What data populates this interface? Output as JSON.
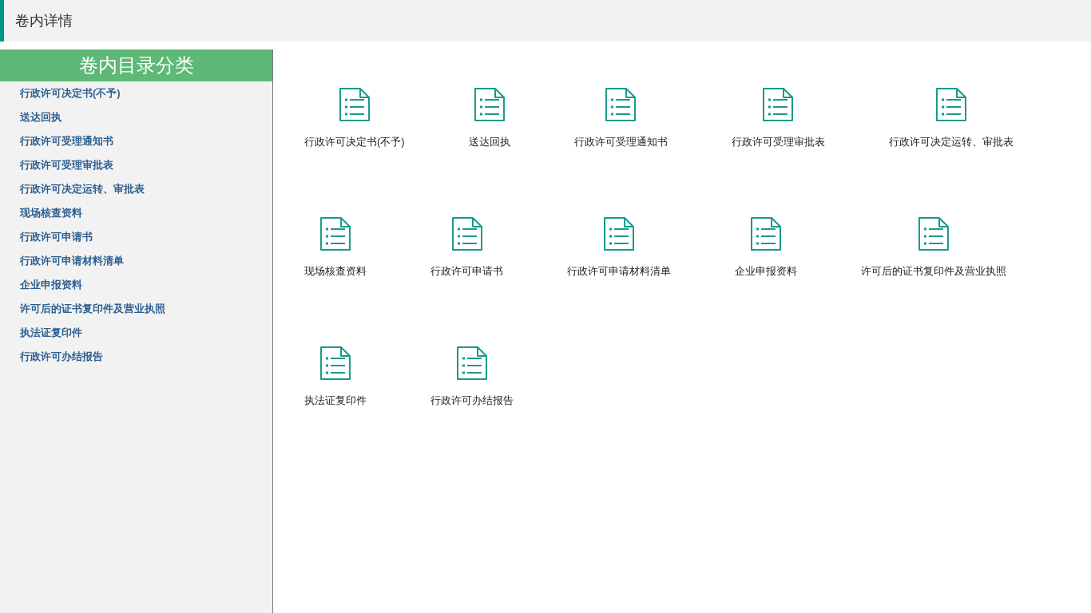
{
  "header": {
    "title": "卷内详情"
  },
  "sidebar": {
    "title": "卷内目录分类",
    "items": [
      "行政许可决定书(不予)",
      "送达回执",
      "行政许可受理通知书",
      "行政许可受理审批表",
      "行政许可决定运转、审批表",
      "现场核查资料",
      "行政许可申请书",
      "行政许可申请材料清单",
      "企业申报资料",
      "许可后的证书复印件及营业执照",
      "执法证复印件",
      "行政许可办结报告"
    ]
  },
  "documents": [
    "行政许可决定书(不予)",
    "送达回执",
    "行政许可受理通知书",
    "行政许可受理审批表",
    "行政许可决定运转、审批表",
    "现场核查资料",
    "行政许可申请书",
    "行政许可申请材料清单",
    "企业申报资料",
    "许可后的证书复印件及营业执照",
    "执法证复印件",
    "行政许可办结报告"
  ]
}
